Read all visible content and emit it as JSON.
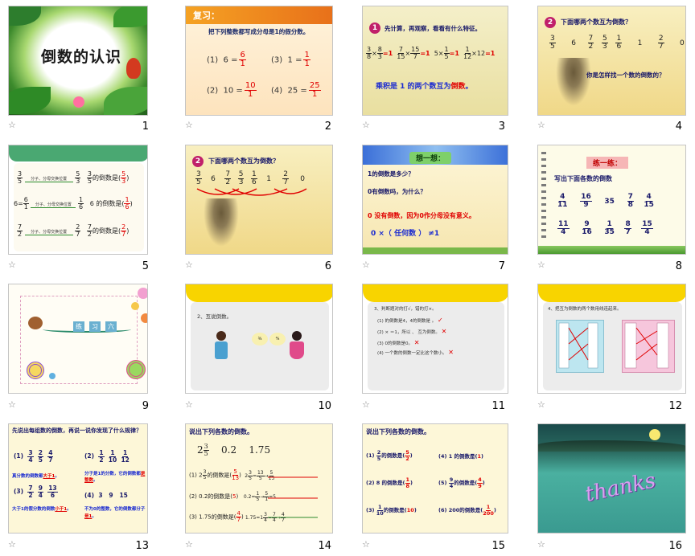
{
  "slide_numbers": [
    "1",
    "2",
    "3",
    "4",
    "5",
    "6",
    "7",
    "8",
    "9",
    "10",
    "11",
    "12",
    "13",
    "14",
    "15",
    "16"
  ],
  "star_icon": "☆",
  "s1": {
    "title": "倒数的认识"
  },
  "s2": {
    "header": "复习：",
    "prompt": "把下列整数都写成分母是1的假分数。",
    "items": [
      {
        "label": "(1)",
        "left": "6 =",
        "num": "6",
        "den": "1"
      },
      {
        "label": "(3)",
        "left": "1 =",
        "num": "1",
        "den": "1"
      },
      {
        "label": "(2)",
        "left": "10 =",
        "num": "10",
        "den": "1"
      },
      {
        "label": "(4)",
        "left": "25 =",
        "num": "25",
        "den": "1"
      }
    ]
  },
  "s3": {
    "badge": "1",
    "title": "先计算，再观察，看看有什么特征。",
    "conclusion_a": "乘积是 1 的两个数互为",
    "conclusion_b": "倒数",
    "conclusion_c": "。",
    "eq_one": "=1"
  },
  "s4": {
    "badge": "2",
    "title": "下面哪两个数互为倒数？",
    "question": "你是怎样找一个数的倒数的？",
    "numbers": [
      {
        "n": "3",
        "d": "5"
      },
      {
        "w": "6"
      },
      {
        "n": "7",
        "d": "2"
      },
      {
        "n": "5",
        "d": "3"
      },
      {
        "n": "1",
        "d": "6"
      },
      {
        "w": "1"
      },
      {
        "n": "2",
        "d": "7"
      },
      {
        "w": "0"
      }
    ]
  },
  "s5": {
    "rows": [
      {
        "left_n": "3",
        "left_d": "5",
        "arrow": "分子、分母交换位置",
        "right_n": "5",
        "right_d": "3",
        "text": "的倒数是(",
        "ans_n": "5",
        "ans_d": "3"
      },
      {
        "left_w": "6",
        "left_n": "6",
        "left_d": "1",
        "arrow": "分子、分母交换位置",
        "right_n": "1",
        "right_d": "6",
        "text": "6 的倒数是(",
        "ans_n": "1",
        "ans_d": "6"
      },
      {
        "left_n": "7",
        "left_d": "2",
        "arrow": "分子、分母交换位置",
        "right_n": "2",
        "right_d": "7",
        "text": "的倒数是(",
        "ans_n": "2",
        "ans_d": "7"
      }
    ]
  },
  "s6": {
    "badge": "2",
    "title": "下面哪两个数互为倒数？"
  },
  "s7": {
    "header": "想一想：",
    "q1": "1的倒数是多少？",
    "q2": "0有倒数吗，为什么？",
    "a1": "0 没有倒数，因为0作分母没有意义。",
    "a2": "0 ×（ 任何数 ） ≠1"
  },
  "s8": {
    "header": "练一练：",
    "prompt": "写出下面各数的倒数",
    "row1": [
      {
        "n": "4",
        "d": "11"
      },
      {
        "n": "16",
        "d": "9"
      },
      {
        "w": "35"
      },
      {
        "n": "7",
        "d": "8"
      },
      {
        "n": "4",
        "d": "15"
      }
    ],
    "row2": [
      {
        "n": "11",
        "d": "4"
      },
      {
        "n": "9",
        "d": "16"
      },
      {
        "n": "1",
        "d": "35"
      },
      {
        "n": "8",
        "d": "7"
      },
      {
        "n": "15",
        "d": "4"
      }
    ]
  },
  "s9": {
    "chars": [
      "练",
      "习",
      "六"
    ]
  },
  "s10": {
    "prompt": "2、互说倒数。"
  },
  "s11": {
    "title": "3、判断题对的打√，错的打×。",
    "items": [
      "(1)  的倒数是4，4的倒数是 。",
      "(2)  × ＝1，所以  、  互为倒数。",
      "(3) 0的倒数是0。",
      "(4) 一个数的倒数一定比这个数小。"
    ]
  },
  "s12": {
    "title": "4、把互为倒数的两个数用线连起来。"
  },
  "s13": {
    "title": "先说出每组数的倒数，再说一说你发现了什么规律？",
    "g1": "(1)",
    "g2": "(2)",
    "g3": "(3)",
    "g4": "(4)",
    "n1": [
      {
        "n": "3",
        "d": "4"
      },
      {
        "n": "2",
        "d": "5"
      },
      {
        "n": "4",
        "d": "7"
      }
    ],
    "n2": [
      {
        "n": "1",
        "d": "2"
      },
      {
        "n": "1",
        "d": "10"
      },
      {
        "n": "1",
        "d": "12"
      }
    ],
    "n3": [
      {
        "n": "7",
        "d": "2"
      },
      {
        "n": "9",
        "d": "4"
      },
      {
        "n": "13",
        "d": "6"
      }
    ],
    "n4": [
      "3",
      "9",
      "15"
    ],
    "r1a": "真分数的倒数都",
    "r1b": "大于1",
    "r1c": "。",
    "r2a": "分子是1的分数，它的倒数都",
    "r2b": "是整数",
    "r2c": "。",
    "r3a": "大于1的假分数的倒数",
    "r3b": "小于1",
    "r3c": "。",
    "r4a": "不为0的整数，它的倒数都分子",
    "r4b": "是1",
    "r4c": "。"
  },
  "s14": {
    "title": "说出下列各数的倒数。",
    "nums": [
      "0.2",
      "1.75"
    ],
    "lines": [
      "(1)  的倒数是(",
      "(2) 0.2的倒数是(",
      "(3) 1.75的倒数是("
    ],
    "ans": [
      "5/13",
      "5",
      "4/7"
    ]
  },
  "s15": {
    "title": "说出下列各数的倒数。",
    "items": [
      {
        "label": "(1)",
        "text": "的倒数是(",
        "ans": "5/2"
      },
      {
        "label": "(2)",
        "text": "8 的倒数是(",
        "ans": "1/8"
      },
      {
        "label": "(3)",
        "text": "的倒数是(",
        "ans": "10"
      },
      {
        "label": "(4)",
        "text": "1 的倒数是(",
        "ans": "1"
      },
      {
        "label": "(5)",
        "text": "的倒数是(",
        "ans": "4/9"
      },
      {
        "label": "(6)",
        "text": "200的倒数是(",
        "ans": "1/200"
      }
    ]
  },
  "s16": {
    "text": "thanks"
  },
  "colors": {
    "accent_red": "#e00000",
    "accent_blue": "#1b2bd0",
    "header_orange": "#e8701a",
    "slide_border": "#c4c4c4"
  }
}
